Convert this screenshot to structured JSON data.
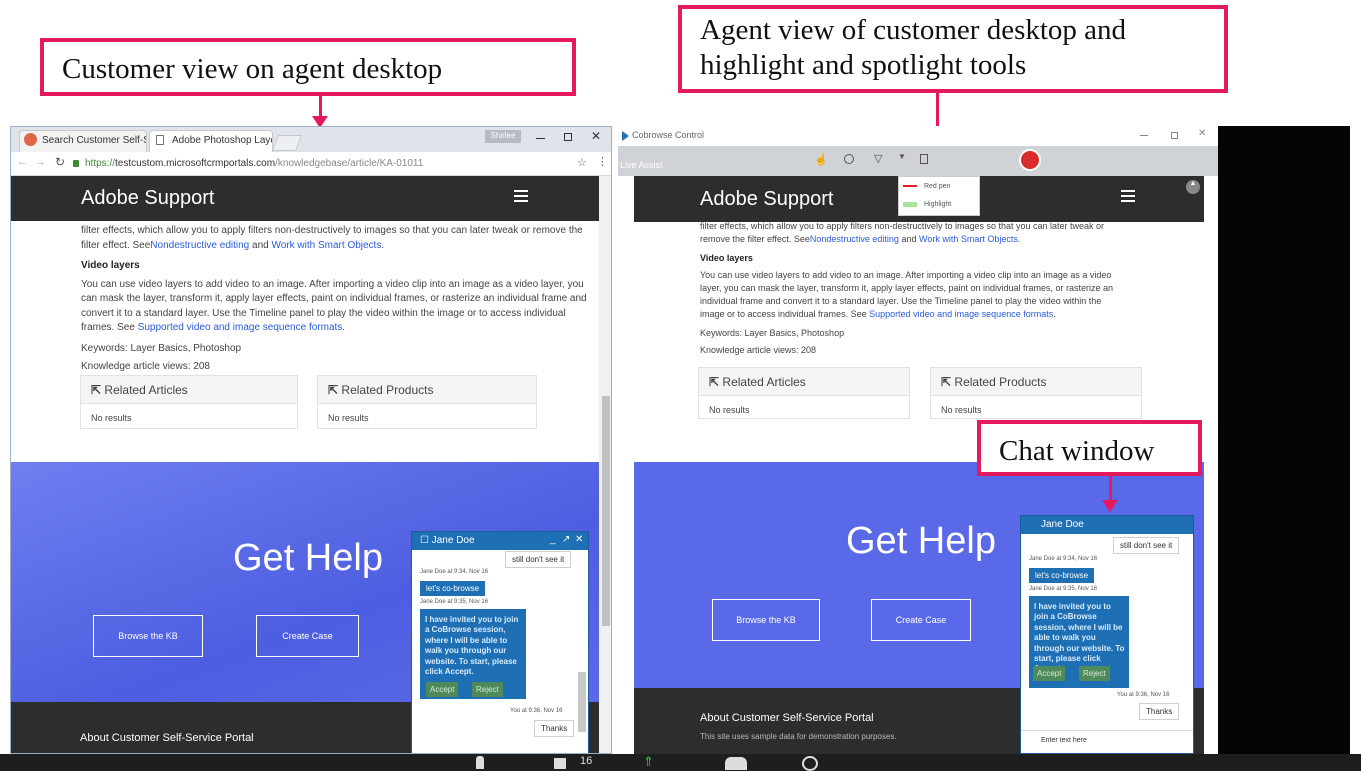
{
  "callouts": {
    "customer_view": "Customer view on agent desktop",
    "agent_view_1": "Agent view of customer desktop and",
    "agent_view_2": "highlight and spotlight tools",
    "chat_window": "Chat window"
  },
  "colors": {
    "callout_border": "#e5195e",
    "header": "#2d2d2d",
    "hero": "#5a69e8",
    "chat_blue": "#1f6fb5",
    "link": "#2a5bd7"
  },
  "browser": {
    "tab1": "Search Customer Self-Service",
    "tab2": "Adobe Photoshop Layer",
    "profile_label": "Shirlee",
    "url_prefix": "https://",
    "url_host": "testcustom.microsoftcrmportals.com",
    "url_path": "/knowledgebase/article/KA-01011"
  },
  "cobrowse": {
    "window_title": "Cobrowse Control",
    "live_assist": "Live Assist",
    "pen_options": [
      "Red pen",
      "Highlight"
    ]
  },
  "site": {
    "title": "Adobe Support",
    "para1_a": "filter effects, which allow you to apply filters non-destructively to images so that you can later tweak or remove the filter effect. See",
    "link_nondestructive": "Nondestructive editing",
    "and": " and ",
    "link_smart": "Work with Smart Objects",
    "period": ".",
    "video_heading": "Video layers",
    "para2": "You can use video layers to add video to an image. After importing a video clip into an image as a video layer, you can mask the layer, transform it, apply layer effects, paint on individual frames, or rasterize an individual frame and convert it to a standard layer. Use the Timeline panel to play the video within the image or to access individual frames. See ",
    "link_formats": "Supported video and image sequence formats",
    "keywords": "Keywords: Layer Basics, Photoshop",
    "views": "Knowledge article views: 208",
    "related_articles": "Related Articles",
    "related_products": "Related Products",
    "no_results": "No results",
    "get_help": "Get Help",
    "browse_kb": "Browse the KB",
    "create_case": "Create Case",
    "about": "About Customer Self-Service Portal",
    "about_sub": "This site uses sample data for demonstration purposes."
  },
  "chat": {
    "name": "Jane Doe",
    "msg1": "still don't see it",
    "meta1": "Jane Doe at 9:34, Nov 16",
    "msg2": "let's co-browse",
    "meta2": "Jane Doe at 9:35, Nov 16",
    "invite": "I have invited you to join a CoBrowse session, where I will be able to walk you through our website. To start, please click Accept.",
    "accept": "Accept",
    "reject": "Reject",
    "meta3": "You at 9:36, Nov 16",
    "thanks": "Thanks",
    "input_placeholder": "Enter text here"
  },
  "taskbar": {
    "count": "16"
  }
}
